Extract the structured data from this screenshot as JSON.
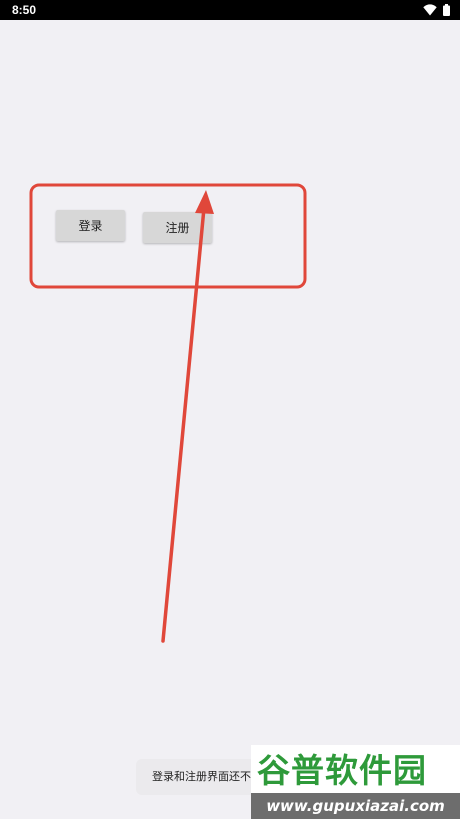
{
  "status_bar": {
    "time": "8:50",
    "icons": [
      "wifi-icon",
      "battery-icon"
    ]
  },
  "buttons": {
    "login_label": "登录",
    "register_label": "注册"
  },
  "toast": {
    "text": "登录和注册界面还不"
  },
  "watermark": {
    "logo_text": "谷普软件园",
    "url": "www.gupuxiazai.com"
  },
  "colors": {
    "background": "#f1f0f4",
    "annotation_red": "#e0473a",
    "button_bg": "#d7d7d7",
    "watermark_green": "#2e9a3a"
  }
}
